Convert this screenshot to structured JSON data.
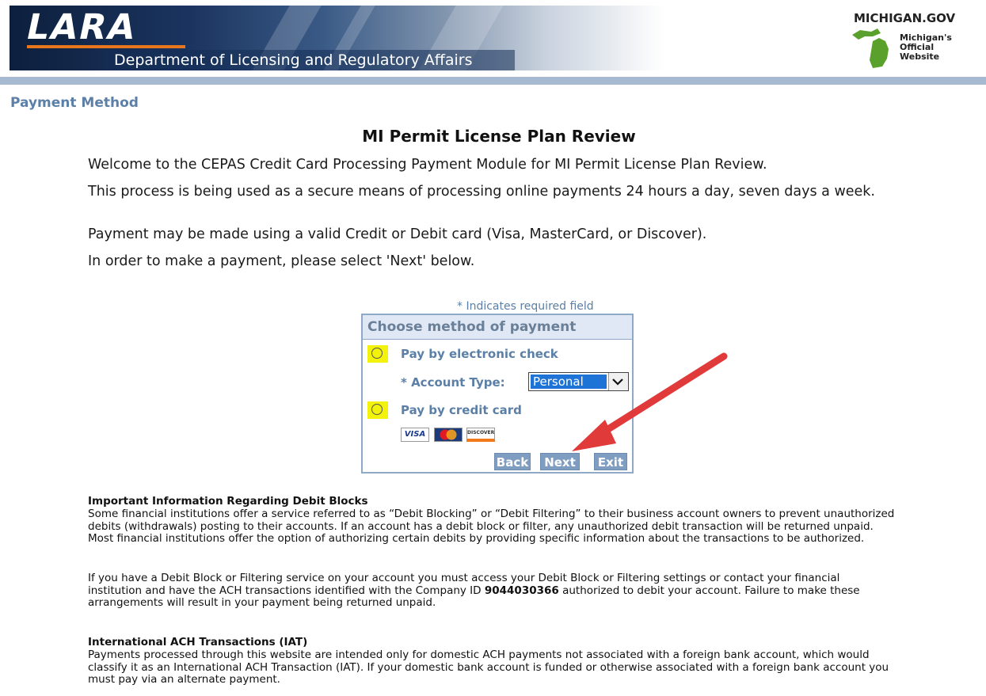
{
  "header": {
    "logo_text": "LARA",
    "department": "Department of Licensing and Regulatory Affairs",
    "michigan_gov": {
      "title": "MICHIGAN.GOV",
      "tagline_lines": [
        "Michigan's",
        "Official",
        "Website"
      ]
    },
    "colors": {
      "banner_dark": "#0d1f3d",
      "accent_orange": "#e8761c",
      "header_rule": "#a7bad1"
    }
  },
  "section_title": "Payment Method",
  "page_title": "MI Permit License Plan Review",
  "intro": {
    "welcome": "Welcome to the CEPAS Credit Card Processing Payment Module for MI Permit License Plan Review.",
    "secure": "This process is being used as a secure means of processing online payments 24 hours a day, seven days a week.",
    "cards": "Payment may be made using a valid Credit or Debit card (Visa, MasterCard, or Discover).",
    "instruction": "In order to make a payment, please select 'Next' below."
  },
  "payment_form": {
    "required_note": "* Indicates required field",
    "title": "Choose method of payment",
    "option_check": "Pay by electronic check",
    "account_type_label": "* Account Type:",
    "account_type_value": "Personal",
    "option_card": "Pay by credit card",
    "card_logos": [
      {
        "icon": "visa-logo-icon",
        "text": "VISA"
      },
      {
        "icon": "mastercard-logo-icon",
        "text": "MasterCard"
      },
      {
        "icon": "discover-logo-icon",
        "text": "DISCOVER"
      }
    ],
    "buttons": {
      "back": "Back",
      "next": "Next",
      "exit": "Exit"
    },
    "highlight_color": "#f2f20a",
    "button_color": "#7f9dc0"
  },
  "annotation": {
    "icon": "red-arrow-icon",
    "color": "#e03a3a"
  },
  "info": {
    "debit_blocks_heading": "Important Information Regarding Debit Blocks",
    "debit_blocks_p1": "Some financial institutions offer a service referred to as “Debit Blocking” or “Debit Filtering” to their business account owners to prevent unauthorized debits (withdrawals) posting to their accounts. If an account has a debit block or filter, any unauthorized debit transaction will be returned unpaid.  Most financial institutions offer the option of authorizing certain debits by providing specific information about the transactions to be authorized.",
    "debit_blocks_p2_before": "If you have a Debit Block or Filtering service on your account you must access your Debit Block or Filtering settings or contact your financial institution and have the ACH transactions identified with the Company ID ",
    "company_id": "9044030366",
    "debit_blocks_p2_after": " authorized to debit your account.  Failure to make these arrangements will result in your payment being returned unpaid.",
    "iat_heading": "International ACH Transactions (IAT)",
    "iat_body": "Payments processed through this website are intended only for domestic ACH payments not associated with a foreign bank account, which would classify it as an International ACH Transaction (IAT). If your domestic bank account is funded or otherwise associated with a foreign bank account you must pay via an alternate payment."
  }
}
